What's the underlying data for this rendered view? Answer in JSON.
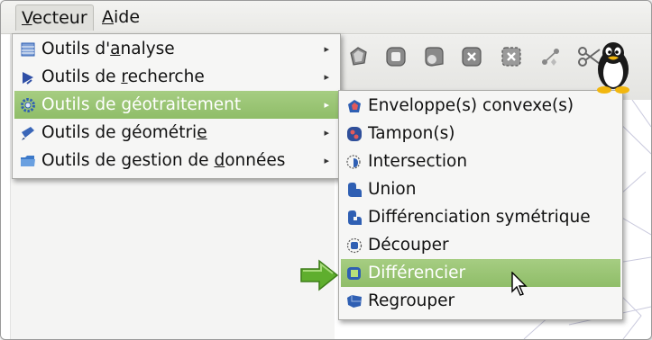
{
  "menubar": {
    "vecteur": {
      "label": "Vecteur",
      "mnemonic_index": 0
    },
    "aide": {
      "label": "Aide",
      "mnemonic_index": 0
    }
  },
  "vector_menu": {
    "items": [
      {
        "pre": "Outils d'",
        "mn": "a",
        "post": "nalyse",
        "icon": "table-icon",
        "submenu": true
      },
      {
        "pre": "Outils de ",
        "mn": "r",
        "post": "echerche",
        "icon": "search-tool-icon",
        "submenu": true
      },
      {
        "pre": "Outils de ",
        "mn": "g",
        "post": "éotraitement",
        "icon": "geoprocessing-gear-icon",
        "submenu": true,
        "highlighted": true
      },
      {
        "pre": "Outils de géométri",
        "mn": "e",
        "post": "",
        "icon": "geometry-pen-icon",
        "submenu": true
      },
      {
        "pre": "Outils de gestion de ",
        "mn": "d",
        "post": "onnées",
        "icon": "folder-icon",
        "submenu": true
      }
    ],
    "submenu_arrow": "▸"
  },
  "geoprocessing_menu": {
    "items": [
      {
        "label": "Enveloppe(s) convexe(s)",
        "icon": "convex-hull-icon"
      },
      {
        "label": "Tampon(s)",
        "icon": "buffer-icon"
      },
      {
        "label": "Intersection",
        "icon": "intersection-icon"
      },
      {
        "label": "Union",
        "icon": "union-icon"
      },
      {
        "label": "Différenciation symétrique",
        "icon": "symmetric-difference-icon"
      },
      {
        "label": "Découper",
        "icon": "clip-icon"
      },
      {
        "label": "Différencier",
        "icon": "difference-icon",
        "highlighted": true
      },
      {
        "label": "Regrouper",
        "icon": "dissolve-icon"
      }
    ]
  },
  "colors": {
    "highlight": "#99c373",
    "menu_bg": "#f6f6f5",
    "icon_blue": "#2f5fb3",
    "arrow_green": "#5fae2e"
  }
}
